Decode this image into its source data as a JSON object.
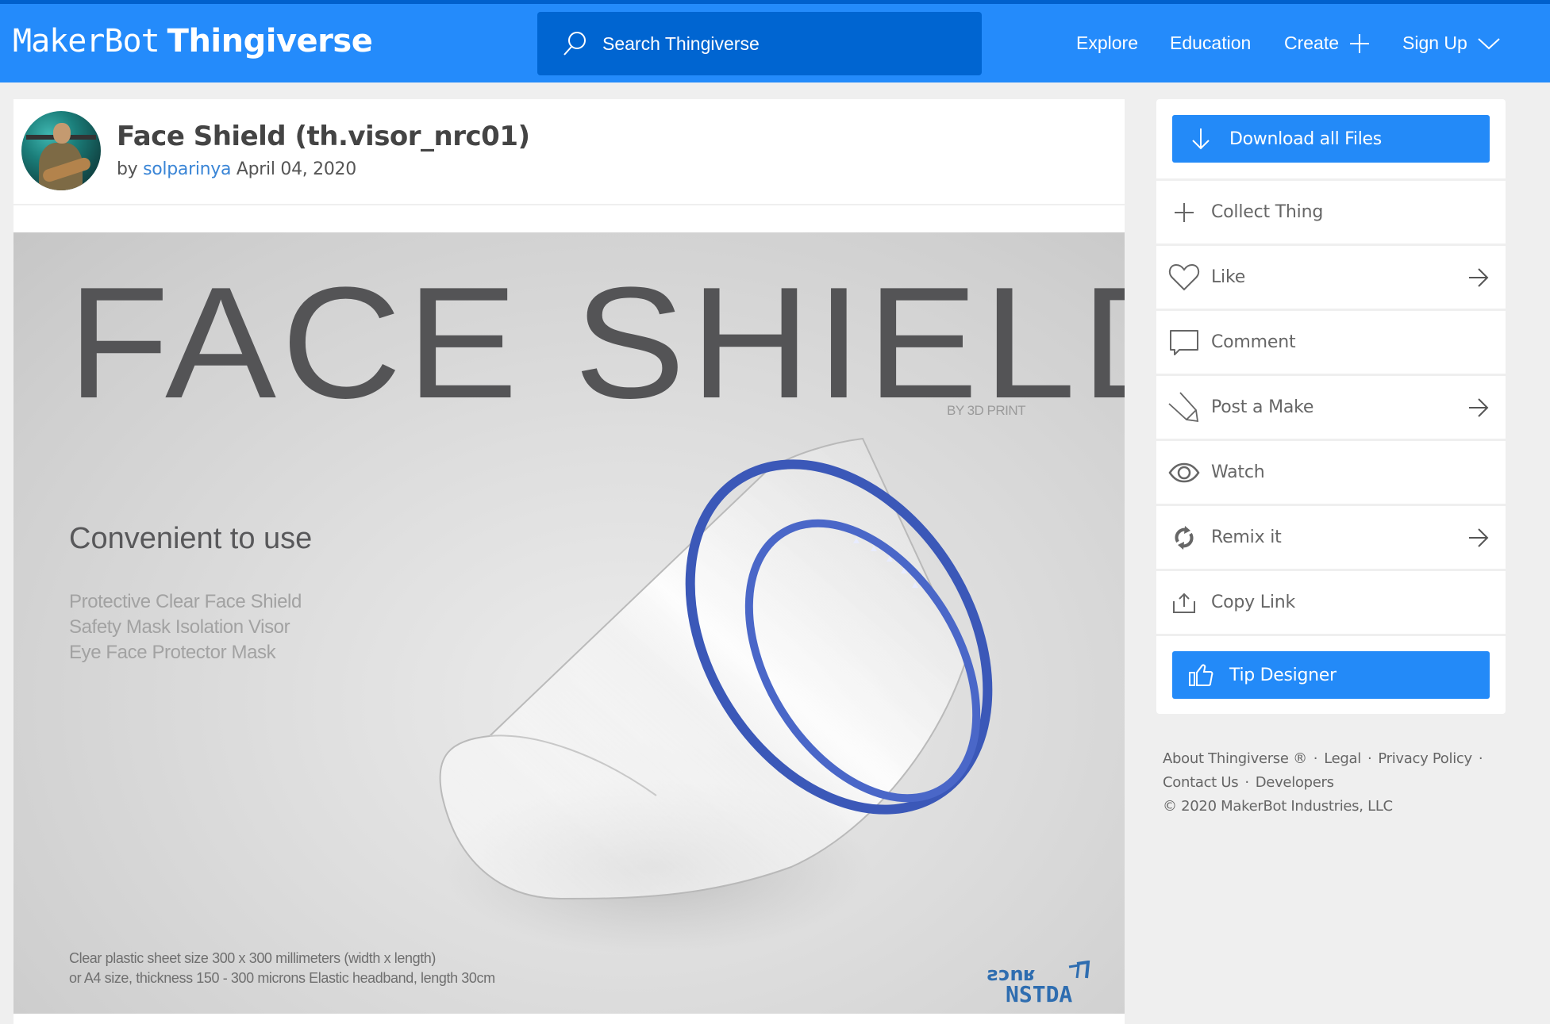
{
  "header": {
    "logo_part1": "MakerBot",
    "logo_part2": "Thingiverse",
    "search_placeholder": "Search Thingiverse",
    "nav": [
      {
        "label": "Explore",
        "icon": null
      },
      {
        "label": "Education",
        "icon": null
      },
      {
        "label": "Create",
        "icon": "plus-icon"
      },
      {
        "label": "Sign Up",
        "icon": "chevron-down-icon"
      }
    ]
  },
  "thing": {
    "title": "Face Shield (th.visor_nrc01)",
    "by_prefix": "by",
    "author": "solparinya",
    "date": "April 04, 2020"
  },
  "hero_image": {
    "headline": "FACE SHIELD",
    "subtitle": "BY 3D PRINT",
    "tagline": "Convenient to use",
    "features": [
      "Protective Clear Face Shield",
      "Safety Mask Isolation Visor",
      "Eye Face Protector Mask"
    ],
    "caption": [
      "Clear plastic sheet size 300 x 300 millimeters (width x length)",
      "or A4 size, thickness 150 - 300 microns Elastic headband, length 30cm"
    ],
    "logo_text": "NSTDA"
  },
  "sidebar": {
    "download_label": "Download all Files",
    "actions": [
      {
        "label": "Collect Thing",
        "icon": "plus-icon",
        "arrow": false
      },
      {
        "label": "Like",
        "icon": "heart-icon",
        "arrow": true
      },
      {
        "label": "Comment",
        "icon": "comment-icon",
        "arrow": false
      },
      {
        "label": "Post a Make",
        "icon": "pencil-icon",
        "arrow": true
      },
      {
        "label": "Watch",
        "icon": "eye-icon",
        "arrow": false
      },
      {
        "label": "Remix it",
        "icon": "remix-icon",
        "arrow": true
      },
      {
        "label": "Copy Link",
        "icon": "share-icon",
        "arrow": false
      }
    ],
    "tip_label": "Tip Designer"
  },
  "footer": {
    "links": [
      "About Thingiverse ®",
      "Legal",
      "Privacy Policy",
      "Contact Us",
      "Developers"
    ],
    "copyright": "©  2020 MakerBot Industries, LLC"
  },
  "colors": {
    "brand_blue": "#248bfb",
    "search_bg": "#0065d1",
    "button_blue": "#238af8",
    "link_blue": "#3a85d6"
  }
}
